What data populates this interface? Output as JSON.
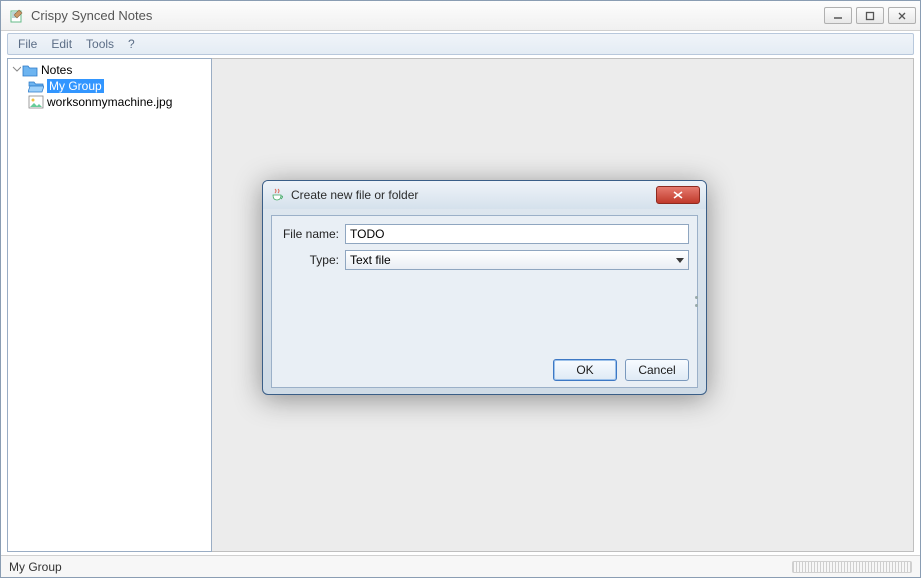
{
  "app": {
    "title": "Crispy Synced Notes"
  },
  "menubar": {
    "items": [
      "File",
      "Edit",
      "Tools",
      "?"
    ]
  },
  "tree": {
    "root": {
      "label": "Notes",
      "icon": "folder-icon"
    },
    "children": [
      {
        "label": "My Group",
        "icon": "folder-open-icon",
        "selected": true
      },
      {
        "label": "worksonmymachine.jpg",
        "icon": "image-file-icon",
        "selected": false
      }
    ]
  },
  "statusbar": {
    "text": "My Group"
  },
  "dialog": {
    "title": "Create new file or folder",
    "filename_label": "File name:",
    "filename_value": "TODO",
    "type_label": "Type:",
    "type_value": "Text file",
    "type_options": [
      "Text file"
    ],
    "ok_label": "OK",
    "cancel_label": "Cancel"
  },
  "icons": {
    "app_icon": "crispy-note-icon",
    "java_icon": "java-cup-icon"
  },
  "colors": {
    "selection": "#3296ff",
    "dialog_close": "#c0392b"
  }
}
